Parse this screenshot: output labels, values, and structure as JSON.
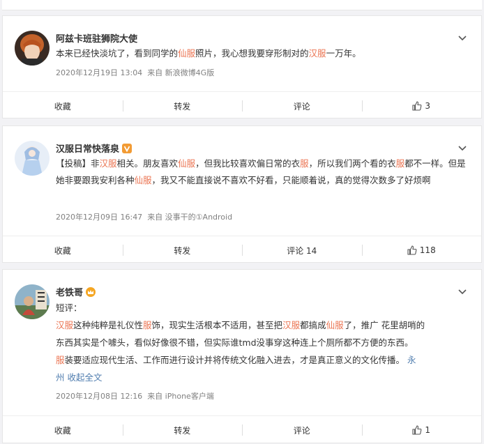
{
  "posts": [
    {
      "username": "阿兹卡班驻狮院大使",
      "text_parts": [
        {
          "t": "本来已经快淡坑了，看到同学的",
          "c": ""
        },
        {
          "t": "仙服",
          "c": "r"
        },
        {
          "t": "照片，我心想我要穿形制对的",
          "c": ""
        },
        {
          "t": "汉服",
          "c": "r"
        },
        {
          "t": "一万年。",
          "c": ""
        }
      ],
      "date": "2020年12月19日 13:04",
      "source": "来自 新浪微博4G版",
      "actions": {
        "collect": "收藏",
        "repost": "转发",
        "comment": "评论",
        "like_count": "3"
      }
    },
    {
      "username": "汉服日常快落泉",
      "text_parts": [
        {
          "t": "【投稿】非",
          "c": ""
        },
        {
          "t": "汉服",
          "c": "r"
        },
        {
          "t": "相关。朋友喜欢",
          "c": ""
        },
        {
          "t": "仙服",
          "c": "r"
        },
        {
          "t": "，但我比较喜欢偏日常的衣",
          "c": ""
        },
        {
          "t": "服",
          "c": "r"
        },
        {
          "t": "，所以我们两个看的衣",
          "c": ""
        },
        {
          "t": "服",
          "c": "r"
        },
        {
          "t": "都不一样。但是她非要跟我安利各种",
          "c": ""
        },
        {
          "t": "仙服",
          "c": "r"
        },
        {
          "t": "，我又不能直接说不喜欢不好看，只能顺着说，真的觉得次数多了好烦啊",
          "c": ""
        }
      ],
      "date": "2020年12月09日 16:47",
      "source": "来自 没事干的①Android",
      "actions": {
        "collect": "收藏",
        "repost": "转发",
        "comment": "评论 14",
        "like_count": "118"
      }
    },
    {
      "username": "老铁哥",
      "date": "2020年12月08日 12:16",
      "source": "来自 iPhone客户端",
      "actions": {
        "collect": "收藏",
        "repost": "转发",
        "comment": "评论",
        "like_count": "1"
      }
    }
  ],
  "post3_lines": {
    "line1": "短评：",
    "line2_parts": [
      {
        "t": "汉服",
        "c": "r"
      },
      {
        "t": "这种纯粹是礼仪性",
        "c": ""
      },
      {
        "t": "服",
        "c": "r"
      },
      {
        "t": "饰，现实生活根本不适用，甚至把",
        "c": ""
      },
      {
        "t": "汉服",
        "c": "r"
      },
      {
        "t": "都搞成",
        "c": ""
      },
      {
        "t": "仙服",
        "c": "r"
      },
      {
        "t": "了，推广 花里胡哨的",
        "c": ""
      }
    ],
    "line3": "东西其实是个噱头，看似好像很不错，但实际谁tmd没事穿这种连上个厕所都不方便的东西。",
    "line4_parts": [
      {
        "t": "服",
        "c": "r"
      },
      {
        "t": "装要适应现代生活、工作而进行设计并将传统文化融入进去，才是真正意义的文化传播。 ",
        "c": ""
      },
      {
        "t": "永",
        "c": "b"
      }
    ],
    "line5_parts": [
      {
        "t": "州",
        "c": "b"
      },
      {
        "t": " 收起全文",
        "c": "b"
      }
    ]
  },
  "colors": {
    "highlight": "#eb7350",
    "link": "#507daf",
    "meta": "#808080"
  }
}
